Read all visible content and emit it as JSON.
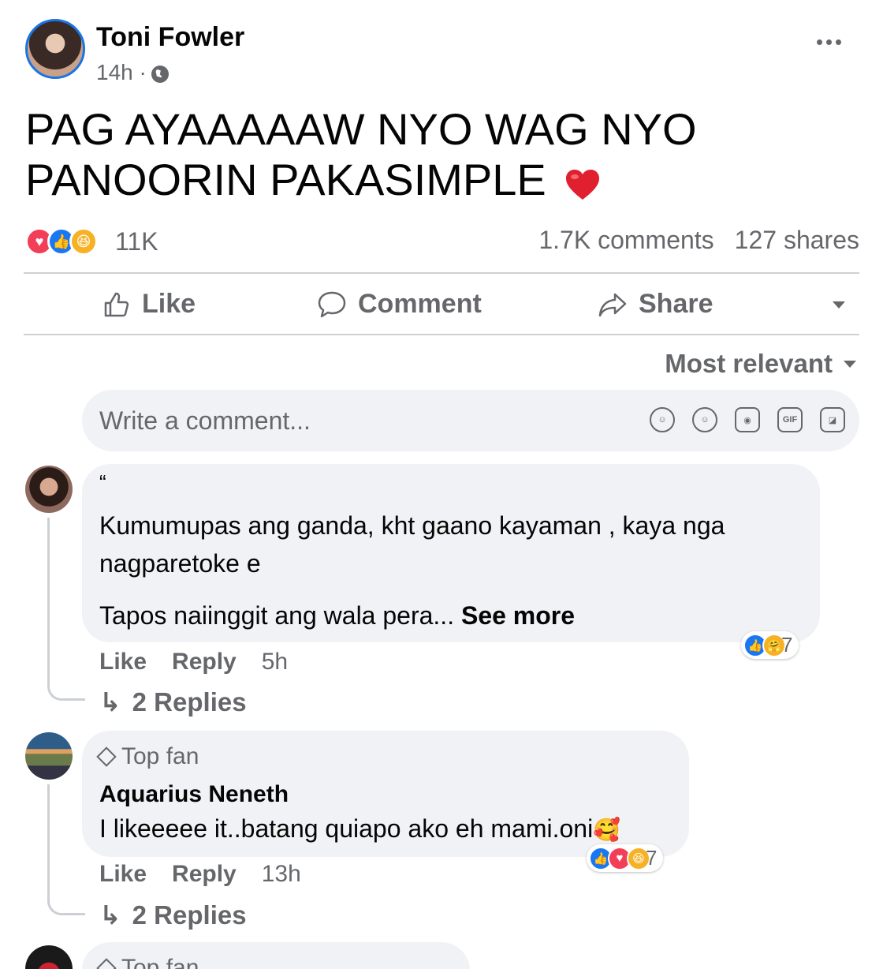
{
  "post": {
    "author": "Toni Fowler",
    "time": "14h ·",
    "text": "PAG AYAAAAAW NYO WAG NYO PANOORIN PAKASIMPLE",
    "reaction_count": "11K",
    "comments_count": "1.7K comments",
    "shares_count": "127 shares"
  },
  "actions": {
    "like": "Like",
    "comment": "Comment",
    "share": "Share"
  },
  "sort_label": "Most relevant",
  "composer": {
    "placeholder": "Write a comment..."
  },
  "comments": [
    {
      "quote_mark": "“",
      "lines": [
        "Kumumupas ang ganda, kht gaano kayaman , kaya nga",
        "nagparetoke e",
        "Tapos naiinggit ang wala pera..."
      ],
      "see_more": "See more",
      "like": "Like",
      "reply": "Reply",
      "time": "5h",
      "reaction_count": "7",
      "replies": "2 Replies"
    },
    {
      "badge": "Top fan",
      "name": "Aquarius Neneth",
      "text": "I likeeeee it..batang quiapo ako eh mami.oni",
      "emoji": "🥰",
      "like": "Like",
      "reply": "Reply",
      "time": "13h",
      "reaction_count": "7",
      "replies": "2 Replies"
    },
    {
      "badge": "Top fan"
    }
  ],
  "colors": {
    "accent": "#1877f2",
    "love": "#f33e58",
    "haha": "#f7b125",
    "secondary_text": "#65676b",
    "bubble": "#f0f2f5"
  }
}
